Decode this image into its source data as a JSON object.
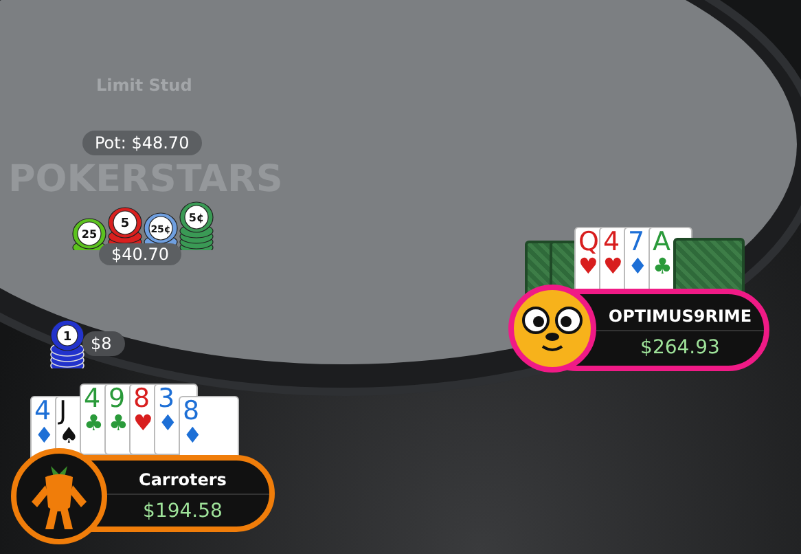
{
  "table": {
    "game": "Limit Stud",
    "logo": "POKERSTARS",
    "pot": "Pot: $48.70",
    "pot_chips": [
      {
        "label": "25",
        "color": "#5cc21f"
      },
      {
        "label": "5",
        "color": "#d9201f"
      },
      {
        "label": "25¢",
        "color": "#6f9fe0"
      },
      {
        "label": "5¢",
        "color": "#3a9a55"
      }
    ],
    "pot_amount": "$40.70"
  },
  "players": [
    {
      "name": "OPTIMUS9RIME",
      "stack": "$264.93",
      "color": "#f01a86",
      "kind": "dog",
      "cards": [
        {
          "face_up": false
        },
        {
          "face_up": false
        },
        {
          "face_up": true,
          "rank": "Q",
          "suit": "♥",
          "color": "#d81e1e"
        },
        {
          "face_up": true,
          "rank": "4",
          "suit": "♥",
          "color": "#d81e1e"
        },
        {
          "face_up": true,
          "rank": "7",
          "suit": "♦",
          "color": "#1d6fd6"
        },
        {
          "face_up": true,
          "rank": "A",
          "suit": "♣",
          "color": "#2a9a3a"
        },
        {
          "face_up": false
        }
      ]
    },
    {
      "name": "Carroters",
      "stack": "$194.58",
      "color": "#f07d0a",
      "kind": "carrot",
      "bet": {
        "chip": {
          "label": "1",
          "color": "#2233cc"
        },
        "amount": "$8"
      },
      "cards": [
        {
          "face_up": true,
          "hole": true,
          "rank": "4",
          "suit": "♦",
          "color": "#1d6fd6"
        },
        {
          "face_up": true,
          "hole": true,
          "rank": "J",
          "suit": "♠",
          "color": "#111111"
        },
        {
          "face_up": true,
          "hole": false,
          "rank": "4",
          "suit": "♣",
          "color": "#2a9a3a"
        },
        {
          "face_up": true,
          "hole": false,
          "rank": "9",
          "suit": "♣",
          "color": "#2a9a3a"
        },
        {
          "face_up": true,
          "hole": false,
          "rank": "8",
          "suit": "♥",
          "color": "#d81e1e"
        },
        {
          "face_up": true,
          "hole": false,
          "rank": "3",
          "suit": "♦",
          "color": "#1d6fd6"
        },
        {
          "face_up": true,
          "hole": true,
          "rank": "8",
          "suit": "♦",
          "color": "#1d6fd6"
        }
      ]
    }
  ]
}
